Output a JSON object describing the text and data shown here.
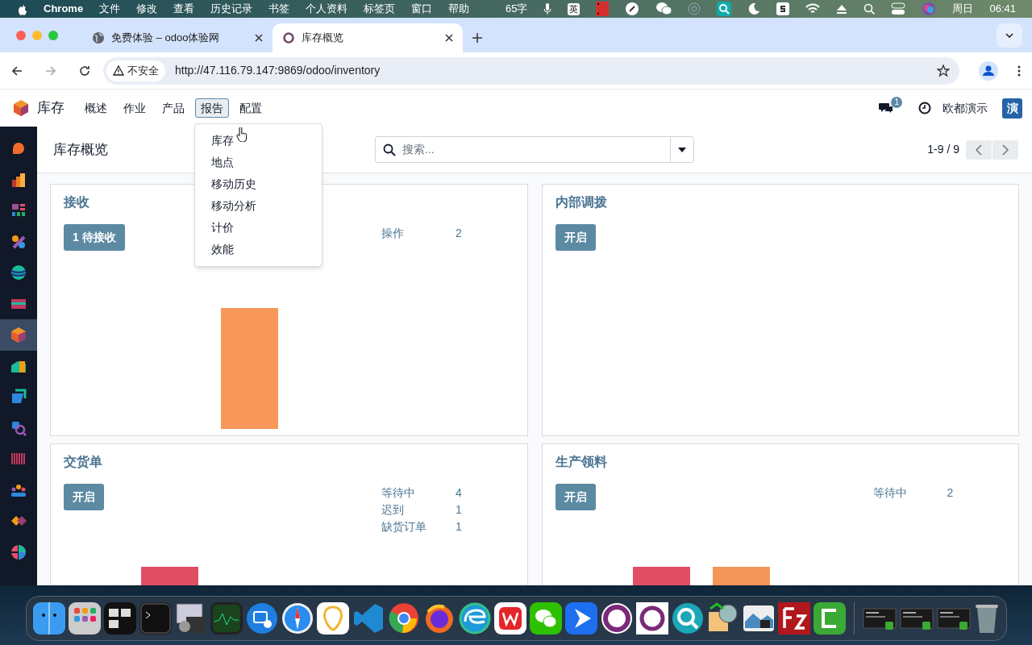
{
  "menubar": {
    "app": "Chrome",
    "items": [
      "文件",
      "修改",
      "查看",
      "历史记录",
      "书签",
      "个人资料",
      "标签页",
      "窗口",
      "帮助"
    ],
    "word_count": "65字",
    "input_method": "英",
    "day": "周日",
    "time": "06:41"
  },
  "browser": {
    "tabs": [
      {
        "title": "免费体验 – odoo体验网",
        "selected": false
      },
      {
        "title": "库存概览",
        "selected": true
      }
    ],
    "security": "不安全",
    "url": "http://47.116.79.147:9869/odoo/inventory"
  },
  "navbar": {
    "app_name": "库存",
    "menu": [
      {
        "label": "概述",
        "selected": false
      },
      {
        "label": "作业",
        "selected": false
      },
      {
        "label": "产品",
        "selected": false
      },
      {
        "label": "报告",
        "selected": true
      },
      {
        "label": "配置",
        "selected": false
      }
    ],
    "messages_badge": "1",
    "user": "欧都演示",
    "avatar": "演"
  },
  "dropdown": [
    "库存",
    "地点",
    "移动历史",
    "移动分析",
    "计价",
    "效能"
  ],
  "control_panel": {
    "title": "库存概览",
    "search": {
      "placeholder": "搜索..."
    },
    "pager": "1-9 / 9"
  },
  "cards": [
    {
      "title": "接收",
      "button": "1 待接收",
      "stats": [
        {
          "label": "操作",
          "value": "2"
        }
      ]
    },
    {
      "title": "内部调拨",
      "button": "开启"
    },
    {
      "title": "交货单",
      "button": "开启",
      "stats": [
        {
          "label": "等待中",
          "value": "4"
        },
        {
          "label": "迟到",
          "value": "1"
        },
        {
          "label": "缺货订单",
          "value": "1"
        }
      ]
    },
    {
      "title": "生产领料",
      "button": "开启",
      "stats": [
        {
          "label": "等待中",
          "value": "2"
        }
      ]
    }
  ]
}
